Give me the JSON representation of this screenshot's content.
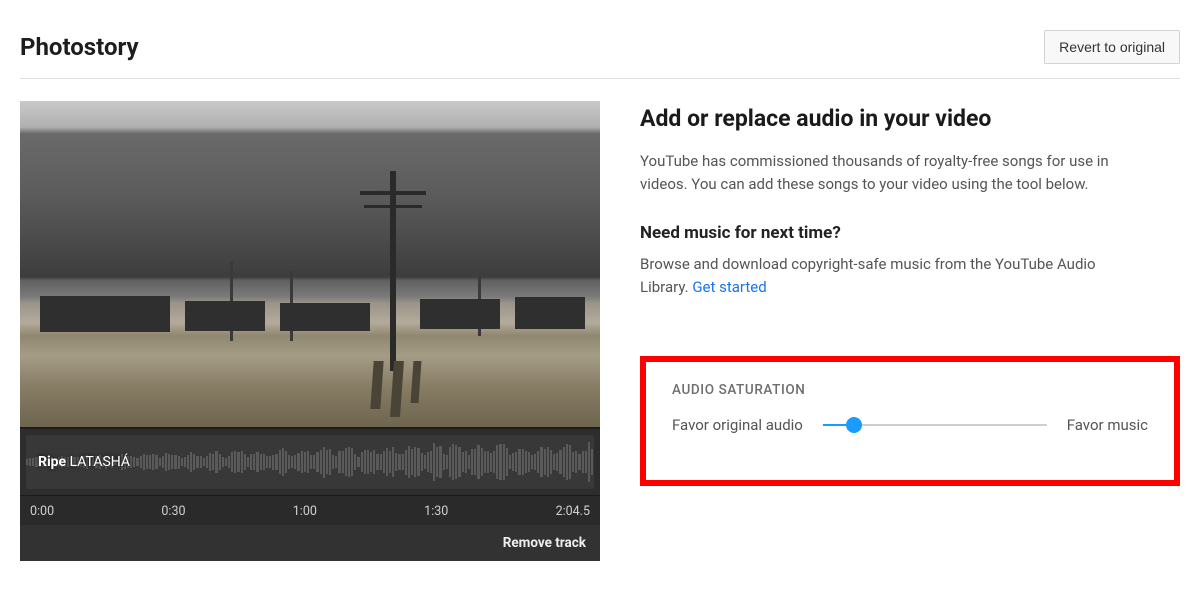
{
  "header": {
    "title": "Photostory",
    "revert_label": "Revert to original"
  },
  "track": {
    "title": "Ripe",
    "artist": "LATASHÁ",
    "remove_label": "Remove track"
  },
  "timeline": {
    "ticks": [
      "0:00",
      "0:30",
      "1:00",
      "1:30",
      "2:04.5"
    ]
  },
  "panel": {
    "heading": "Add or replace audio in your video",
    "desc": "YouTube has commissioned thousands of royalty-free songs for use in videos. You can add these songs to your video using the tool below.",
    "sub_heading": "Need music for next time?",
    "sub_desc": "Browse and download copyright-safe music from the YouTube Audio Library. ",
    "link_label": "Get started"
  },
  "saturation": {
    "title": "AUDIO SATURATION",
    "left_label": "Favor original audio",
    "right_label": "Favor music",
    "value_percent": 14
  }
}
